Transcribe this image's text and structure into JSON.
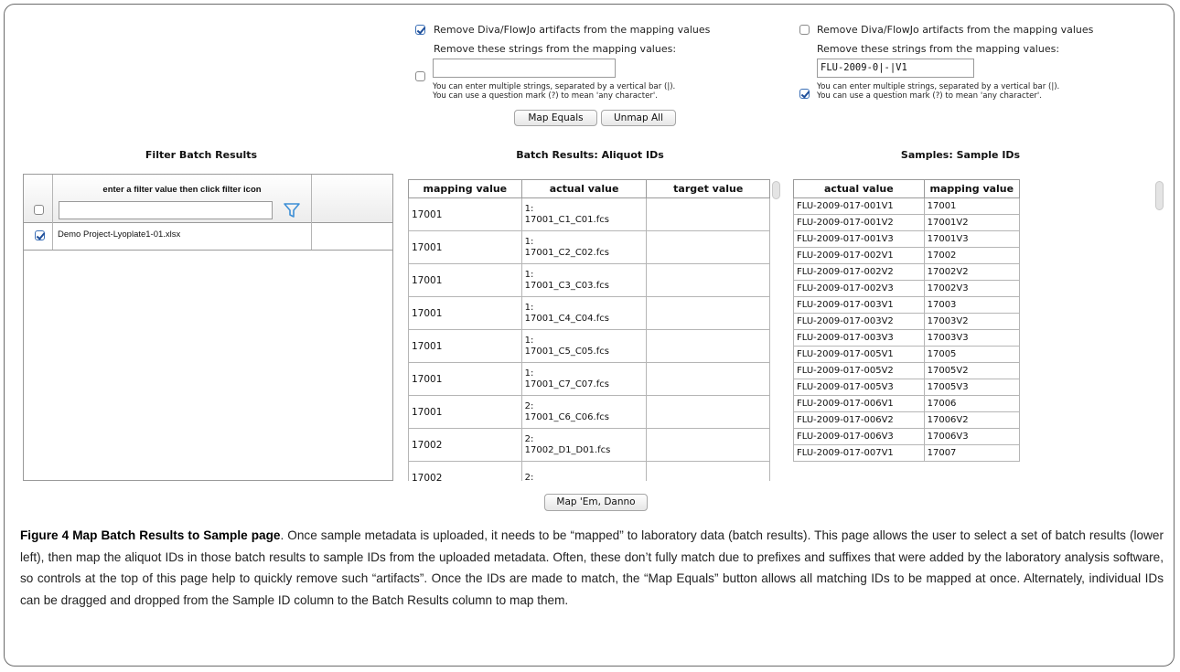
{
  "middle_options": {
    "artifacts_checked": true,
    "artifacts_label": "Remove Diva/FlowJo artifacts from the mapping values",
    "strings_label": "Remove these strings from the mapping values:",
    "strings_checked": false,
    "strings_value": "",
    "help1": "You can enter multiple strings, separated by a vertical bar (|).",
    "help2": "You can use a question mark (?) to mean 'any character'.",
    "map_equals": "Map Equals",
    "unmap_all": "Unmap All"
  },
  "right_options": {
    "artifacts_checked": false,
    "artifacts_label": "Remove Diva/FlowJo artifacts from the mapping values",
    "strings_label": "Remove these strings from the mapping values:",
    "strings_checked": true,
    "strings_value": "FLU-2009-0|-|V1",
    "help1": "You can enter multiple strings, separated by a vertical bar (|).",
    "help2": "You can use a question mark (?) to mean 'any character'."
  },
  "filter_section": {
    "title": "Filter Batch Results",
    "header_label": "enter a filter value then click filter icon",
    "filter_value": "",
    "filter_icon": "funnel-icon",
    "rows": [
      {
        "checked": true,
        "name": "Demo Project-Lyoplate1-01.xlsx"
      }
    ]
  },
  "batch_section": {
    "title": "Batch Results: Aliquot IDs",
    "columns": [
      "mapping value",
      "actual value",
      "target value"
    ],
    "rows": [
      {
        "mapping": "17001",
        "prefix": "1:",
        "file": "17001_C1_C01.fcs",
        "target": ""
      },
      {
        "mapping": "17001",
        "prefix": "1:",
        "file": "17001_C2_C02.fcs",
        "target": ""
      },
      {
        "mapping": "17001",
        "prefix": "1:",
        "file": "17001_C3_C03.fcs",
        "target": ""
      },
      {
        "mapping": "17001",
        "prefix": "1:",
        "file": "17001_C4_C04.fcs",
        "target": ""
      },
      {
        "mapping": "17001",
        "prefix": "1:",
        "file": "17001_C5_C05.fcs",
        "target": ""
      },
      {
        "mapping": "17001",
        "prefix": "1:",
        "file": "17001_C7_C07.fcs",
        "target": ""
      },
      {
        "mapping": "17001",
        "prefix": "2:",
        "file": "17001_C6_C06.fcs",
        "target": ""
      },
      {
        "mapping": "17002",
        "prefix": "2:",
        "file": "17002_D1_D01.fcs",
        "target": ""
      },
      {
        "mapping": "17002",
        "prefix": "2:",
        "file": "",
        "target": ""
      }
    ]
  },
  "samples_section": {
    "title": "Samples: Sample IDs",
    "columns": [
      "actual value",
      "mapping value"
    ],
    "rows": [
      [
        "FLU-2009-017-001V1",
        "17001"
      ],
      [
        "FLU-2009-017-001V2",
        "17001V2"
      ],
      [
        "FLU-2009-017-001V3",
        "17001V3"
      ],
      [
        "FLU-2009-017-002V1",
        "17002"
      ],
      [
        "FLU-2009-017-002V2",
        "17002V2"
      ],
      [
        "FLU-2009-017-002V3",
        "17002V3"
      ],
      [
        "FLU-2009-017-003V1",
        "17003"
      ],
      [
        "FLU-2009-017-003V2",
        "17003V2"
      ],
      [
        "FLU-2009-017-003V3",
        "17003V3"
      ],
      [
        "FLU-2009-017-005V1",
        "17005"
      ],
      [
        "FLU-2009-017-005V2",
        "17005V2"
      ],
      [
        "FLU-2009-017-005V3",
        "17005V3"
      ],
      [
        "FLU-2009-017-006V1",
        "17006"
      ],
      [
        "FLU-2009-017-006V2",
        "17006V2"
      ],
      [
        "FLU-2009-017-006V3",
        "17006V3"
      ],
      [
        "FLU-2009-017-007V1",
        "17007"
      ]
    ]
  },
  "map_button": "Map 'Em, Danno",
  "caption": {
    "title": "Figure 4 Map Batch Results to Sample page",
    "body": ". Once sample metadata is uploaded, it needs to be “mapped” to laboratory data (batch results). This page allows the user to select a set of batch results (lower left), then map the aliquot IDs in those batch results to sample IDs from the uploaded metadata. Often, these don’t fully match due to prefixes and suffixes that were added by the laboratory analysis software, so controls at the top of this page help to quickly remove such “artifacts”. Once the IDs are made to match, the “Map Equals” button allows all matching IDs to be mapped at once. Alternately, individual IDs can be dragged and dropped from the Sample ID column to the Batch Results column to map them."
  }
}
